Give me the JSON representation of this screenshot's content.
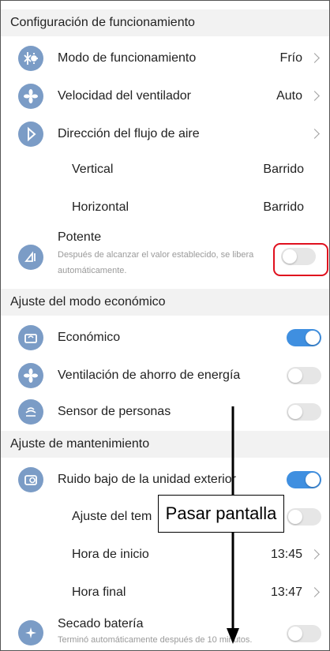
{
  "sections": {
    "operation": "Configuración de funcionamiento",
    "economy": "Ajuste del modo económico",
    "maintenance": "Ajuste de mantenimiento"
  },
  "operation": {
    "mode": {
      "label": "Modo de funcionamiento",
      "value": "Frío",
      "icon": "snowflake-sun-icon"
    },
    "fan": {
      "label": "Velocidad del ventilador",
      "value": "Auto",
      "icon": "fan-icon"
    },
    "airflow": {
      "label": "Dirección del flujo de aire",
      "icon": "airflow-icon"
    },
    "vertical": {
      "label": "Vertical",
      "value": "Barrido"
    },
    "horizontal": {
      "label": "Horizontal",
      "value": "Barrido"
    },
    "powerful": {
      "label": "Potente",
      "desc_line1": "Después de alcanzar el valor establecido, se libera",
      "desc_line2": "automáticamente.",
      "on": false,
      "icon": "powerful-icon"
    }
  },
  "economy": {
    "eco": {
      "label": "Económico",
      "on": true,
      "icon": "eco-icon"
    },
    "vent": {
      "label": "Ventilación de ahorro de energía",
      "on": false,
      "icon": "fan-icon"
    },
    "sensor": {
      "label": "Sensor de personas",
      "on": false,
      "icon": "sensor-icon"
    }
  },
  "maintenance": {
    "quiet": {
      "label": "Ruido bajo de la unidad exterior",
      "on": true,
      "icon": "outdoor-unit-icon"
    },
    "schedule": {
      "label": "Ajuste del tem"
    },
    "start": {
      "label": "Hora de inicio",
      "value": "13:45"
    },
    "end": {
      "label": "Hora final",
      "value": "13:47"
    },
    "dry": {
      "label": "Secado batería",
      "desc": "Terminó automáticamente después de 10 minutos.",
      "on": false,
      "icon": "sparkle-icon"
    }
  },
  "callout": {
    "text": "Pasar pantalla"
  },
  "colors": {
    "accent": "#3f8fe0",
    "icon_bg": "#7b9cc6",
    "highlight": "#e0101e",
    "section_bg": "#f2f2f2"
  }
}
